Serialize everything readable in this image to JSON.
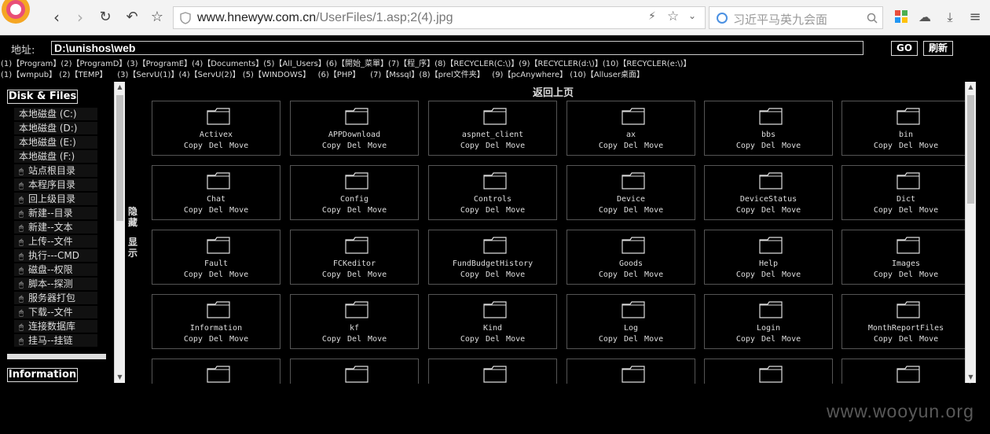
{
  "browser": {
    "url_host": "www.hnewyw.com.cn",
    "url_path": "/UserFiles/1.asp;2(4).jpg",
    "search_text": "习近平马英九会面"
  },
  "page": {
    "address_label": "地址:",
    "address_value": "D:\\unishos\\web",
    "go_label": "GO",
    "refresh_label": "刷新",
    "shortcuts_row1": "(1)【Program】(2)【ProgramD】(3)【ProgramE】(4)【Documents】(5)【All_Users】(6)【開始_菜單】(7)【程_序】(8)【RECYCLER(C:\\)】(9)【RECYCLER(d:\\)】(10)【RECYCLER(e:\\)】",
    "shortcuts_row2": "(1)【wmpub】 (2)【TEMP】    (3)【ServU(1)】(4)【ServU(2)】 (5)【WINDOWS】   (6)【PHP】    (7)【Mssql】(8)【prel文件夹】   (9)【pcAnywhere】 (10)【Alluser桌面】",
    "disk_title": "Disk & Files",
    "info_title": "Information",
    "toggle_hide": "隐藏",
    "toggle_show": "显示",
    "back_label": "返回上页",
    "watermark": "www.wooyun.org"
  },
  "sidebar": {
    "disks": [
      {
        "label": "本地磁盘 (C:)"
      },
      {
        "label": "本地磁盘 (D:)"
      },
      {
        "label": "本地磁盘 (E:)"
      },
      {
        "label": "本地磁盘 (F:)"
      }
    ],
    "items": [
      {
        "label": "站点根目录"
      },
      {
        "label": "本程序目录"
      },
      {
        "label": "回上级目录"
      },
      {
        "label": "新建--目录"
      },
      {
        "label": "新建--文本"
      },
      {
        "label": "上传--文件"
      },
      {
        "label": "执行---CMD"
      },
      {
        "label": "磁盘--权限"
      },
      {
        "label": "脚本--探测"
      },
      {
        "label": "服务器打包"
      },
      {
        "label": "下载--文件"
      },
      {
        "label": "连接数据库"
      },
      {
        "label": "挂马--挂链"
      }
    ]
  },
  "folders": [
    {
      "name": "Activex"
    },
    {
      "name": "APPDownload"
    },
    {
      "name": "aspnet_client"
    },
    {
      "name": "ax"
    },
    {
      "name": "bbs"
    },
    {
      "name": "bin"
    },
    {
      "name": "Chat"
    },
    {
      "name": "Config"
    },
    {
      "name": "Controls"
    },
    {
      "name": "Device"
    },
    {
      "name": "DeviceStatus"
    },
    {
      "name": "Dict"
    },
    {
      "name": "Fault"
    },
    {
      "name": "FCKeditor"
    },
    {
      "name": "FundBudgetHistory"
    },
    {
      "name": "Goods"
    },
    {
      "name": "Help"
    },
    {
      "name": "Images"
    },
    {
      "name": "Information"
    },
    {
      "name": "kf"
    },
    {
      "name": "Kind"
    },
    {
      "name": "Log"
    },
    {
      "name": "Login"
    },
    {
      "name": "MonthReportFiles"
    },
    {
      "name": ""
    },
    {
      "name": ""
    },
    {
      "name": ""
    },
    {
      "name": ""
    },
    {
      "name": ""
    },
    {
      "name": ""
    }
  ],
  "folder_actions": "Copy Del Move"
}
